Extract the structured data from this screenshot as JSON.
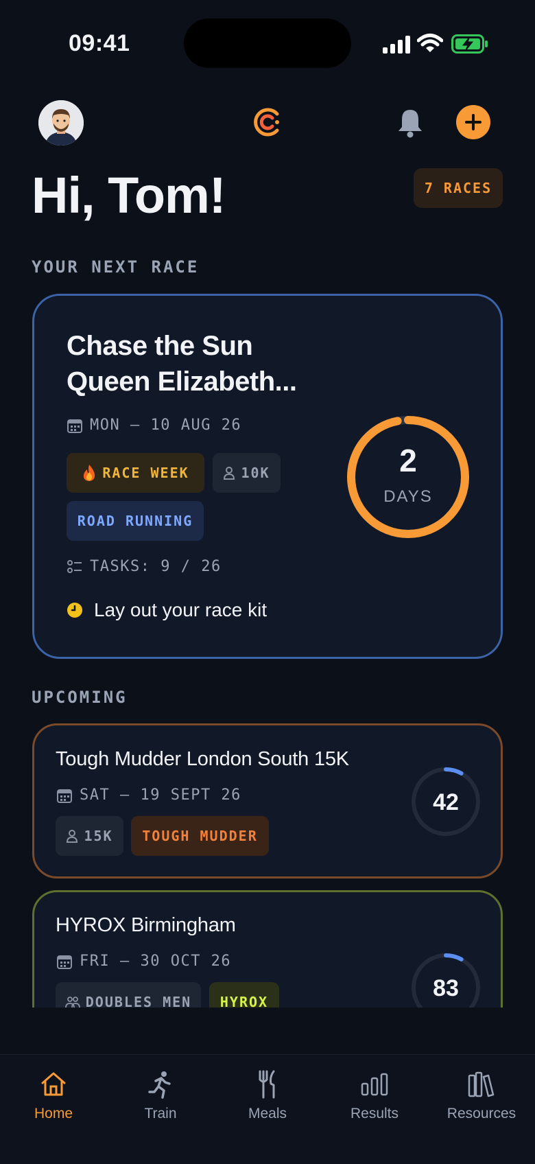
{
  "status_bar": {
    "time": "09:41"
  },
  "header": {
    "greeting": "Hi, Tom!",
    "races_badge": "7 RACES"
  },
  "next_race": {
    "section_label": "YOUR NEXT RACE",
    "title_line1": "Chase the Sun",
    "title_line2": "Queen Elizabeth...",
    "date": "MON – 10 AUG 26",
    "chips": {
      "race_week": "RACE WEEK",
      "distance": "10K",
      "category": "ROAD RUNNING"
    },
    "tasks": "TASKS: 9 / 26",
    "current_task": "Lay out your race kit",
    "countdown": {
      "value": "2",
      "unit": "DAYS",
      "progress": 0.97
    },
    "accent": "#f89a35"
  },
  "upcoming": {
    "section_label": "UPCOMING",
    "races": [
      {
        "title": "Tough Mudder London South 15K",
        "date": "SAT – 19 SEPT 26",
        "distance": "15K",
        "category": "TOUGH MUDDER",
        "days": "42",
        "progress": 0.08,
        "border": "#7a4a2a",
        "category_bg": "#3a2418",
        "category_color": "#f3813a"
      },
      {
        "title": "HYROX Birmingham",
        "date": "FRI – 30 OCT 26",
        "distance": "DOUBLES MEN",
        "category": "HYROX",
        "days": "83",
        "progress": 0.08,
        "border": "#5f6f2e",
        "category_bg": "#2a3118",
        "category_color": "#d7f24a"
      }
    ]
  },
  "tabs": [
    {
      "label": "Home",
      "icon": "home-icon",
      "active": true
    },
    {
      "label": "Train",
      "icon": "runner-icon",
      "active": false
    },
    {
      "label": "Meals",
      "icon": "utensils-icon",
      "active": false
    },
    {
      "label": "Results",
      "icon": "bar-chart-icon",
      "active": false
    },
    {
      "label": "Resources",
      "icon": "books-icon",
      "active": false
    }
  ],
  "colors": {
    "background": "#0b1019",
    "card": "#111827",
    "accent_orange": "#f89a35",
    "blue_border": "#3c63a8",
    "road_running": "#7fa8ff",
    "battery_green": "#35c759"
  }
}
